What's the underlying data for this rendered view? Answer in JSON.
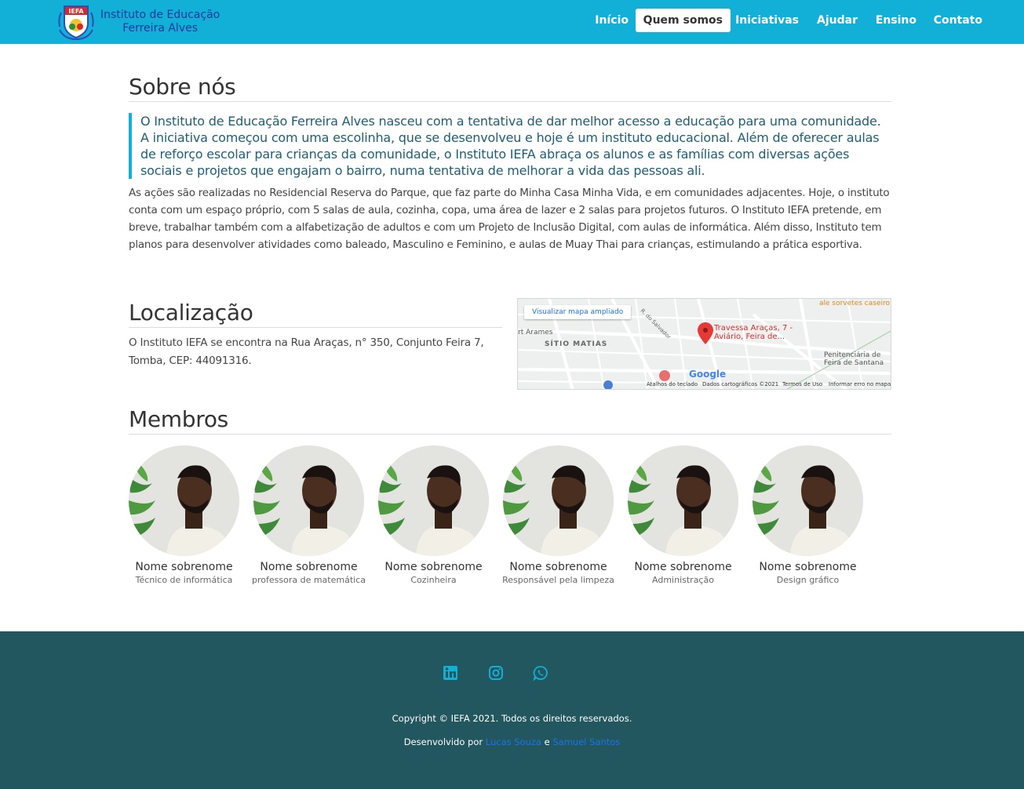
{
  "brand": {
    "logo_text": "IEFA",
    "name_line1": "Instituto de Educação",
    "name_line2": "Ferreira Alves"
  },
  "nav": {
    "items": [
      {
        "label": "Início"
      },
      {
        "label": "Quem somos"
      },
      {
        "label": "Iniciativas"
      },
      {
        "label": "Ajudar"
      },
      {
        "label": "Ensino"
      },
      {
        "label": "Contato"
      }
    ],
    "active": "Quem somos"
  },
  "about": {
    "title": "Sobre nós",
    "lead": "O Instituto de Educação Ferreira Alves nasceu com a tentativa de dar melhor acesso a educação para uma comunidade. A iniciativa começou com uma escolinha, que se desenvolveu e hoje é um instituto educacional. Além de oferecer aulas de reforço escolar para crianças da comunidade, o Instituto IEFA abraça os alunos e as famílias com diversas ações sociais e projetos que engajam o bairro, numa tentativa de melhorar a vida das pessoas ali.",
    "body": "As ações são realizadas no Residencial Reserva do Parque, que faz parte do Minha Casa Minha Vida, e em comunidades adjacentes. Hoje, o instituto conta com um espaço próprio, com 5 salas de aula, cozinha, copa, uma área de lazer e 2 salas para projetos futuros. O Instituto IEFA pretende, em breve, trabalhar também com a alfabetização de adultos e com um Projeto de Inclusão Digital, com aulas de informática. Além disso, Instituto tem planos para desenvolver atividades como baleado, Masculino e Feminino, e aulas de Muay Thai para crianças, estimulando a prática esportiva."
  },
  "location": {
    "title": "Localização",
    "text": "O Instituto IEFA se encontra na Rua Araças, n° 350, Conjunto Feira 7, Tomba, CEP: 44091316.",
    "map": {
      "enlarge_button": "Visualizar mapa ampliado",
      "pin_label_line1": "Travessa Araças, 7 -",
      "pin_label_line2": "Aviário, Feira de...",
      "top_label": "ale sorvetes caseiro",
      "district": "SÍTIO MATIAS",
      "left_label": "rt Arames",
      "street_salvador": "R. do Salvador",
      "prison_line1": "Penitenciária de",
      "prison_line2": "Feira de Santana",
      "google": "Google",
      "footer_shortcuts": "Atalhos do teclado",
      "footer_data": "Dados cartográficos ©2021",
      "footer_terms": "Termos de Uso",
      "footer_report": "Informar erro no mapa"
    }
  },
  "members": {
    "title": "Membros",
    "items": [
      {
        "name": "Nome sobrenome",
        "role": "Técnico de informática"
      },
      {
        "name": "Nome sobrenome",
        "role": "professora de matemática"
      },
      {
        "name": "Nome sobrenome",
        "role": "Cozinheira"
      },
      {
        "name": "Nome sobrenome",
        "role": "Responsável pela limpeza"
      },
      {
        "name": "Nome sobrenome",
        "role": "Administração"
      },
      {
        "name": "Nome sobrenome",
        "role": "Design gráfico"
      }
    ]
  },
  "footer": {
    "social_icons": [
      "linkedin-icon",
      "instagram-icon",
      "whatsapp-icon"
    ],
    "copyright": "Copyright © IEFA 2021. Todos os direitos reservados.",
    "dev_prefix": "Desenvolvido por",
    "dev_and": "e",
    "dev_1": "Lucas Souza",
    "dev_2": "Samuel Santos"
  },
  "colors": {
    "navbar": "#12b0d7",
    "footer": "#22575f",
    "lead_text": "#1e5f73",
    "accent": "#12b0d7",
    "link": "#1a73e8"
  }
}
